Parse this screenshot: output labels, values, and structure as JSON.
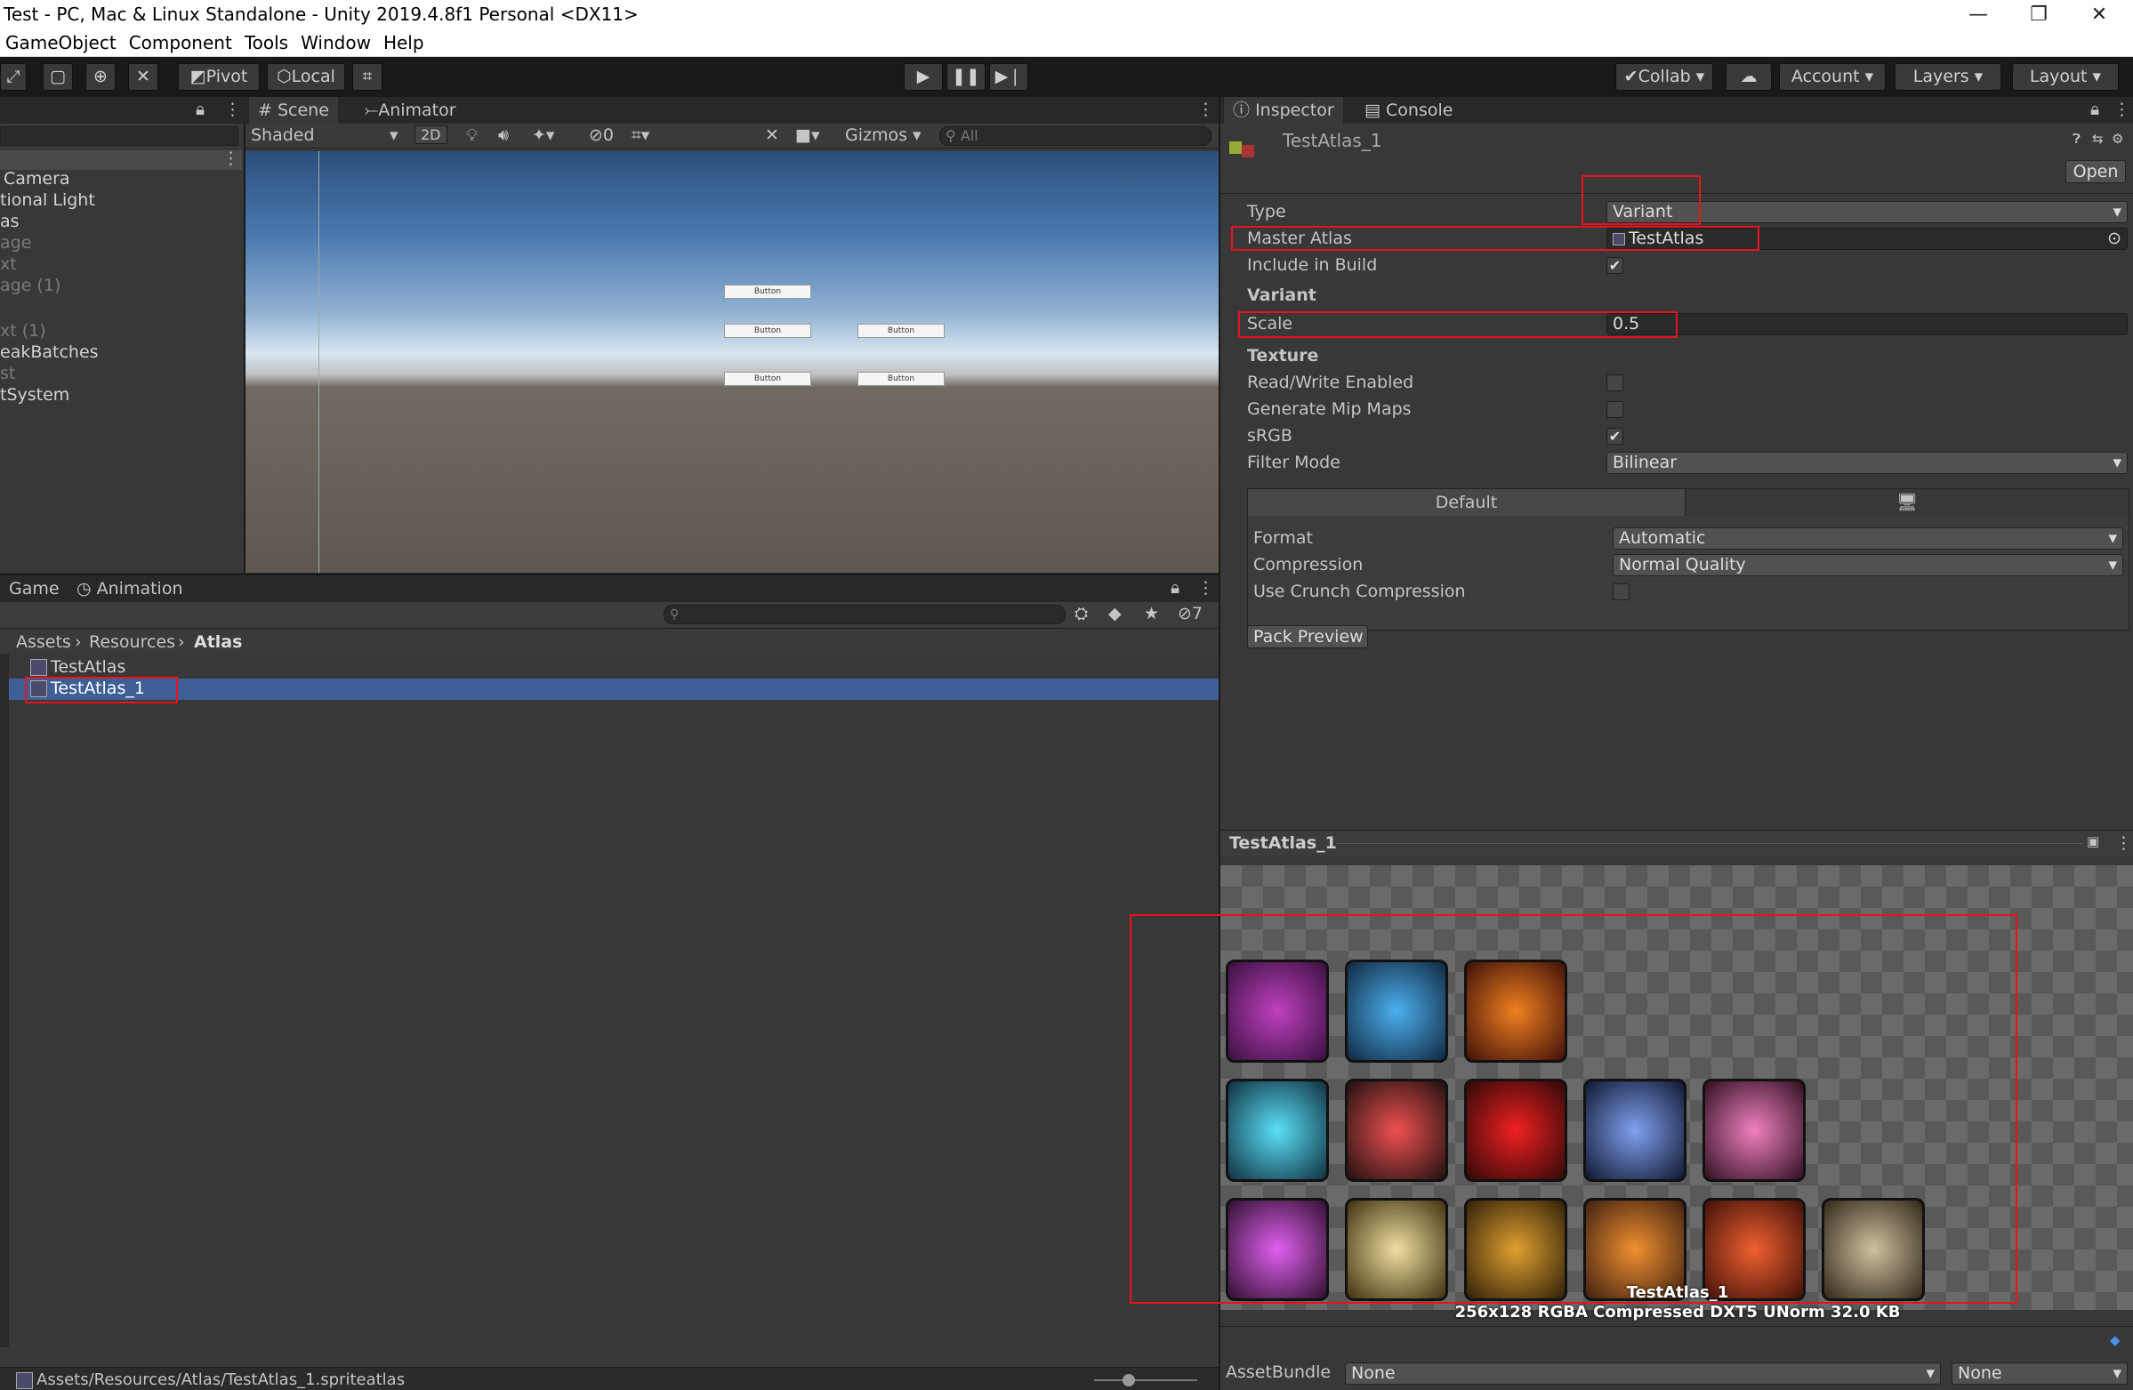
{
  "window": {
    "title": "Test - PC, Mac & Linux Standalone - Unity 2019.4.8f1 Personal <DX11>",
    "minimize": "—",
    "maximize": "❐",
    "close": "✕"
  },
  "menu": [
    "GameObject",
    "Component",
    "Tools",
    "Window",
    "Help"
  ],
  "toolbar": {
    "pivot": "Pivot",
    "local": "Local",
    "collab": "Collab",
    "account": "Account",
    "layers": "Layers",
    "layout": "Layout"
  },
  "hierarchy": {
    "items": [
      "Camera",
      "tional Light",
      "as",
      "age",
      "xt",
      "age (1)",
      "xt (1)",
      "eakBatches",
      "st",
      "tSystem"
    ]
  },
  "scene": {
    "tabs": [
      "Scene",
      "Animator"
    ],
    "shading": "Shaded",
    "mode2d": "2D",
    "hidden_count": "0",
    "gizmos": "Gizmos",
    "search_placeholder": "All",
    "button_label": "Button"
  },
  "project": {
    "tabs": [
      "Game",
      "Animation"
    ],
    "breadcrumb": [
      "Assets",
      "Resources",
      "Atlas"
    ],
    "files": [
      "TestAtlas",
      "TestAtlas_1"
    ],
    "hidden_count": "7",
    "status_path": "Assets/Resources/Atlas/TestAtlas_1.spriteatlas"
  },
  "inspector": {
    "tabs": [
      "Inspector",
      "Console"
    ],
    "asset_name": "TestAtlas_1",
    "open_button": "Open",
    "type_label": "Type",
    "type_value": "Variant",
    "master_label": "Master Atlas",
    "master_value": "TestAtlas",
    "include_label": "Include in Build",
    "include_checked": true,
    "variant_header": "Variant",
    "scale_label": "Scale",
    "scale_value": "0.5",
    "texture_header": "Texture",
    "readwrite_label": "Read/Write Enabled",
    "readwrite_checked": false,
    "mipmaps_label": "Generate Mip Maps",
    "mipmaps_checked": false,
    "srgb_label": "sRGB",
    "srgb_checked": true,
    "filter_label": "Filter Mode",
    "filter_value": "Bilinear",
    "platform_default": "Default",
    "format_label": "Format",
    "format_value": "Automatic",
    "compression_label": "Compression",
    "compression_value": "Normal Quality",
    "crunch_label": "Use Crunch Compression",
    "crunch_checked": false,
    "pack_preview": "Pack Preview"
  },
  "preview": {
    "title": "TestAtlas_1",
    "caption_name": "TestAtlas_1",
    "caption_info": "256x128 RGBA Compressed DXT5 UNorm   32.0 KB"
  },
  "assetbundle": {
    "label": "AssetBundle",
    "name_value": "None",
    "variant_value": "None"
  },
  "colors": {
    "accent_selection": "#3e5f96",
    "highlight_box": "#e8141b"
  }
}
